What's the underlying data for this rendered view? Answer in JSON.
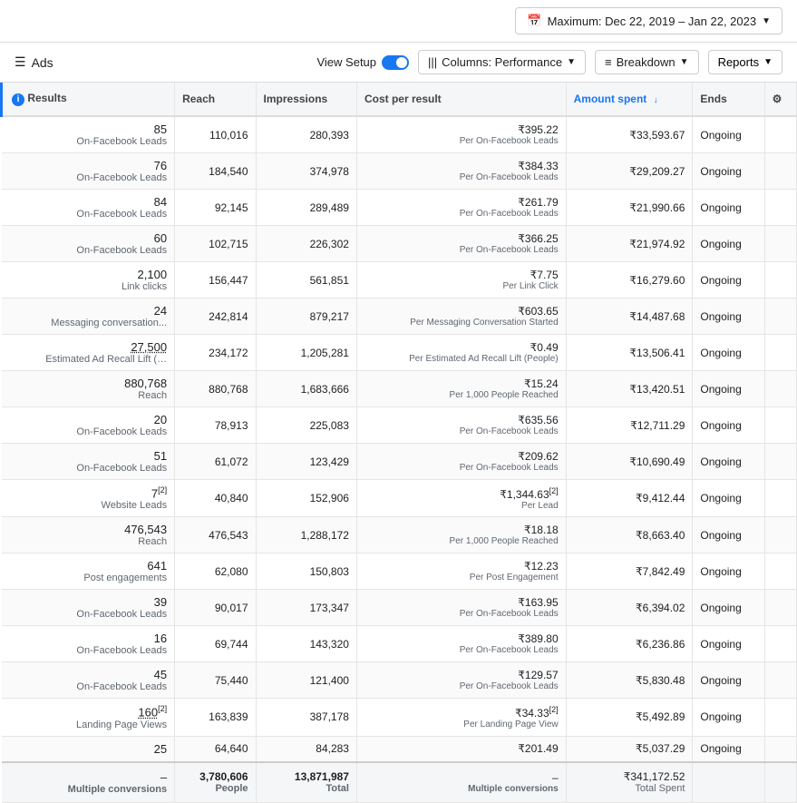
{
  "topbar": {
    "date_range": "Maximum: Dec 22, 2019 – Jan 22, 2023"
  },
  "toolbar": {
    "ads_icon": "☰",
    "ads_label": "Ads",
    "view_setup_label": "View Setup",
    "columns_btn": "Columns: Performance",
    "breakdown_btn": "Breakdown",
    "reports_btn": "Reports"
  },
  "table": {
    "columns": [
      {
        "id": "results",
        "label": "Results",
        "has_info": true,
        "sorted": false
      },
      {
        "id": "reach",
        "label": "Reach",
        "sorted": false
      },
      {
        "id": "impressions",
        "label": "Impressions",
        "sorted": false
      },
      {
        "id": "cost_per_result",
        "label": "Cost per result",
        "sorted": false
      },
      {
        "id": "amount_spent",
        "label": "Amount spent ↓",
        "sorted": true
      },
      {
        "id": "ends",
        "label": "Ends",
        "sorted": false
      },
      {
        "id": "settings",
        "label": "",
        "sorted": false
      }
    ],
    "rows": [
      {
        "results_val": "85",
        "results_label": "On-Facebook Leads",
        "reach": "110,016",
        "impressions": "280,393",
        "cost_val": "₹395.22",
        "cost_label": "Per On-Facebook Leads",
        "amount": "₹33,593.67",
        "ends": "Ongoing"
      },
      {
        "results_val": "76",
        "results_label": "On-Facebook Leads",
        "reach": "184,540",
        "impressions": "374,978",
        "cost_val": "₹384.33",
        "cost_label": "Per On-Facebook Leads",
        "amount": "₹29,209.27",
        "ends": "Ongoing"
      },
      {
        "results_val": "84",
        "results_label": "On-Facebook Leads",
        "reach": "92,145",
        "impressions": "289,489",
        "cost_val": "₹261.79",
        "cost_label": "Per On-Facebook Leads",
        "amount": "₹21,990.66",
        "ends": "Ongoing"
      },
      {
        "results_val": "60",
        "results_label": "On-Facebook Leads",
        "reach": "102,715",
        "impressions": "226,302",
        "cost_val": "₹366.25",
        "cost_label": "Per On-Facebook Leads",
        "amount": "₹21,974.92",
        "ends": "Ongoing"
      },
      {
        "results_val": "2,100",
        "results_label": "Link clicks",
        "reach": "156,447",
        "impressions": "561,851",
        "cost_val": "₹7.75",
        "cost_label": "Per Link Click",
        "amount": "₹16,279.60",
        "ends": "Ongoing"
      },
      {
        "results_val": "24",
        "results_label": "Messaging conversation...",
        "reach": "242,814",
        "impressions": "879,217",
        "cost_val": "₹603.65",
        "cost_label": "Per Messaging Conversation Started",
        "amount": "₹14,487.68",
        "ends": "Ongoing"
      },
      {
        "results_val": "27,500",
        "results_label": "Estimated Ad Recall Lift (…",
        "results_underline": true,
        "reach": "234,172",
        "impressions": "1,205,281",
        "cost_val": "₹0.49",
        "cost_label": "Per Estimated Ad Recall Lift (People)",
        "amount": "₹13,506.41",
        "ends": "Ongoing"
      },
      {
        "results_val": "880,768",
        "results_label": "Reach",
        "reach": "880,768",
        "impressions": "1,683,666",
        "cost_val": "₹15.24",
        "cost_label": "Per 1,000 People Reached",
        "amount": "₹13,420.51",
        "ends": "Ongoing"
      },
      {
        "results_val": "20",
        "results_label": "On-Facebook Leads",
        "reach": "78,913",
        "impressions": "225,083",
        "cost_val": "₹635.56",
        "cost_label": "Per On-Facebook Leads",
        "amount": "₹12,711.29",
        "ends": "Ongoing"
      },
      {
        "results_val": "51",
        "results_label": "On-Facebook Leads",
        "reach": "61,072",
        "impressions": "123,429",
        "cost_val": "₹209.62",
        "cost_label": "Per On-Facebook Leads",
        "amount": "₹10,690.49",
        "ends": "Ongoing"
      },
      {
        "results_val": "7",
        "results_sup": "[2]",
        "results_label": "Website Leads",
        "reach": "40,840",
        "impressions": "152,906",
        "cost_val": "₹1,344.63",
        "cost_sup": "[2]",
        "cost_label": "Per Lead",
        "amount": "₹9,412.44",
        "ends": "Ongoing"
      },
      {
        "results_val": "476,543",
        "results_label": "Reach",
        "reach": "476,543",
        "impressions": "1,288,172",
        "cost_val": "₹18.18",
        "cost_label": "Per 1,000 People Reached",
        "amount": "₹8,663.40",
        "ends": "Ongoing"
      },
      {
        "results_val": "641",
        "results_label": "Post engagements",
        "reach": "62,080",
        "impressions": "150,803",
        "cost_val": "₹12.23",
        "cost_label": "Per Post Engagement",
        "amount": "₹7,842.49",
        "ends": "Ongoing"
      },
      {
        "results_val": "39",
        "results_label": "On-Facebook Leads",
        "reach": "90,017",
        "impressions": "173,347",
        "cost_val": "₹163.95",
        "cost_label": "Per On-Facebook Leads",
        "amount": "₹6,394.02",
        "ends": "Ongoing"
      },
      {
        "results_val": "16",
        "results_label": "On-Facebook Leads",
        "reach": "69,744",
        "impressions": "143,320",
        "cost_val": "₹389.80",
        "cost_label": "Per On-Facebook Leads",
        "amount": "₹6,236.86",
        "ends": "Ongoing"
      },
      {
        "results_val": "45",
        "results_label": "On-Facebook Leads",
        "reach": "75,440",
        "impressions": "121,400",
        "cost_val": "₹129.57",
        "cost_label": "Per On-Facebook Leads",
        "amount": "₹5,830.48",
        "ends": "Ongoing"
      },
      {
        "results_val": "160",
        "results_sup": "[2]",
        "results_label": "Landing Page Views",
        "results_underline": true,
        "reach": "163,839",
        "impressions": "387,178",
        "cost_val": "₹34.33",
        "cost_sup": "[2]",
        "cost_label": "Per Landing Page View",
        "amount": "₹5,492.89",
        "ends": "Ongoing"
      },
      {
        "results_val": "25",
        "results_label": "",
        "reach": "64,640",
        "impressions": "84,283",
        "cost_val": "₹201.49",
        "cost_label": "",
        "amount": "₹5,037.29",
        "ends": "Ongoing"
      }
    ],
    "footer": {
      "results_val": "–",
      "results_label": "Multiple conversions",
      "reach_val": "3,780,606",
      "reach_label": "People",
      "impressions_val": "13,871,987",
      "impressions_label": "Total",
      "cost_val": "–",
      "cost_label": "Multiple conversions",
      "amount_val": "₹341,172.52",
      "amount_label": "Total Spent",
      "ends": ""
    }
  }
}
